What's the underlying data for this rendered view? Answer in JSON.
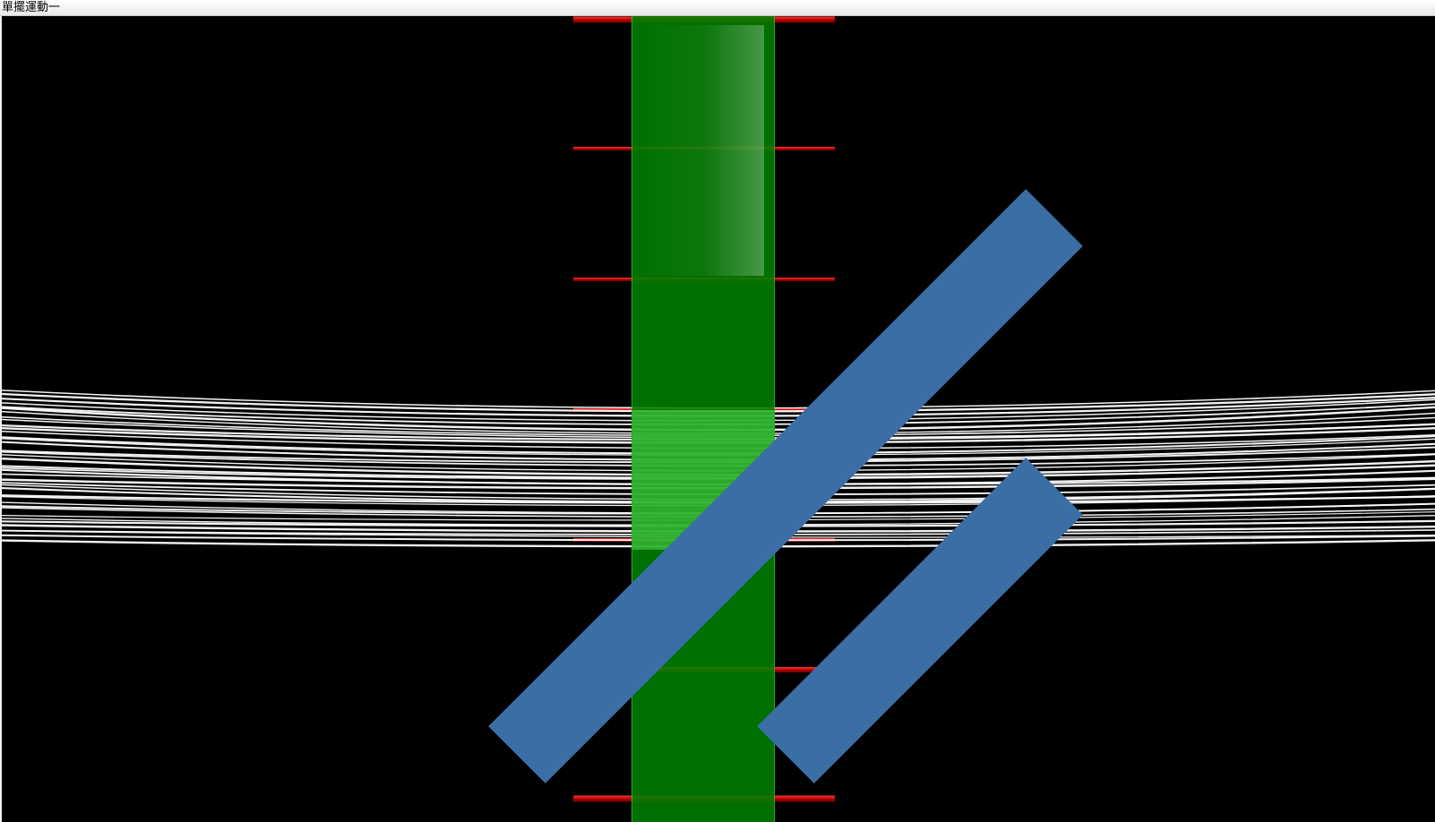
{
  "window": {
    "title": "單擺運動一"
  },
  "scene": {
    "background_color": "#000000",
    "green_band_color": "#008000",
    "green_band_highlight_color": "#4fd84f",
    "bar_color": "#b30000",
    "string_color": "#ffffff",
    "red_bar_count": 7,
    "string_count": 40
  },
  "icons": {
    "resize_grip": "resize-grip-icon"
  }
}
